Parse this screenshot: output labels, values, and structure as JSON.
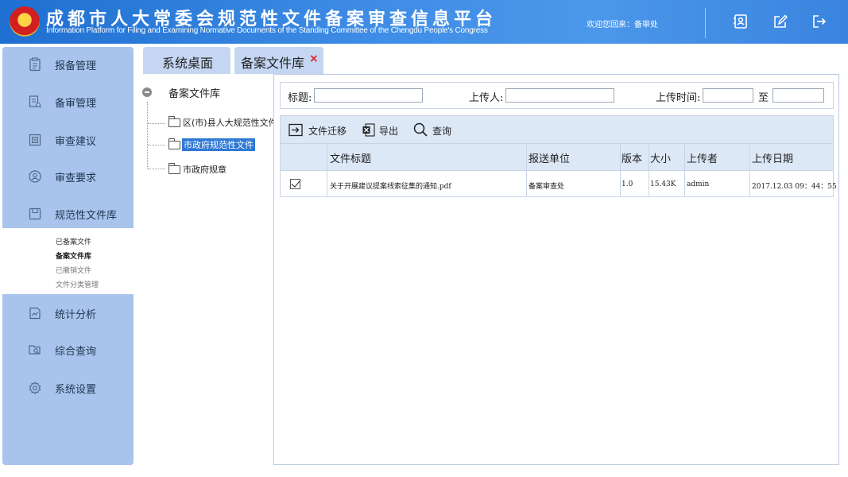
{
  "header": {
    "title_cn": "成都市人大常委会规范性文件备案审查信息平台",
    "title_en": "Information Platform for Filing and Examining Normative Documents of the Standing Committee of the Chengdu People's Congress",
    "welcome": "欢迎您回来：备审处",
    "icons": [
      "contacts-icon",
      "edit-icon",
      "logout-icon"
    ]
  },
  "sidebar": {
    "items": [
      {
        "label": "报备管理",
        "icon": "clipboard-icon"
      },
      {
        "label": "备审管理",
        "icon": "review-document-icon"
      },
      {
        "label": "审查建议",
        "icon": "suggestion-icon"
      },
      {
        "label": "审查要求",
        "icon": "user-circle-icon"
      },
      {
        "label": "规范性文件库",
        "icon": "archive-box-icon"
      },
      {
        "label": "统计分析",
        "icon": "chart-document-icon"
      },
      {
        "label": "综合查询",
        "icon": "search-folder-icon"
      },
      {
        "label": "系统设置",
        "icon": "gear-icon"
      }
    ],
    "submenu": [
      "已备案文件",
      "备案文件库",
      "已撤销文件",
      "文件分类管理"
    ]
  },
  "tabs": [
    {
      "label": "系统桌面"
    },
    {
      "label": "备案文件库",
      "close": "×"
    }
  ],
  "tree": {
    "root": "备案文件库",
    "children": [
      "区(市)县人大规范性文件",
      "市政府规范性文件",
      "市政府规章"
    ]
  },
  "search": {
    "title_label": "标题:",
    "uploader_label": "上传人:",
    "time_label": "上传时间:",
    "to_label": "至",
    "title_value": "",
    "uploader_value": "",
    "time_from": "",
    "time_to": ""
  },
  "toolbar": {
    "migrate": "文件迁移",
    "export": "导出",
    "query": "查询"
  },
  "table": {
    "headers": [
      "文件标题",
      "报送单位",
      "版本",
      "大小",
      "上传者",
      "上传日期"
    ],
    "rows": [
      {
        "checked": true,
        "title": "关于开展建议提案线索征集的通知.pdf",
        "unit": "备案审查处",
        "version": "1.0",
        "size": "15.43K",
        "uploader": "admin",
        "date": "2017.12.03 09：44：55"
      }
    ]
  },
  "colors": {
    "header_blue": "#3f8de6",
    "sidebar_bg": "#a9c4ec",
    "tab_bg": "#c4d6f1",
    "grid_head_bg": "#dde8f7",
    "tree_selected": "#2f78d4",
    "close_red": "#dd2222"
  }
}
